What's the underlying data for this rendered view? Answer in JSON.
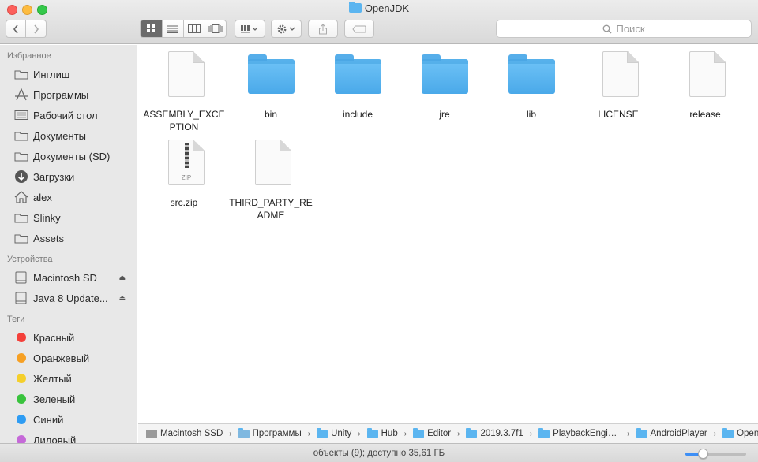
{
  "window": {
    "title": "OpenJDK"
  },
  "toolbar": {
    "back_icon": "chevron-left-icon",
    "forward_icon": "chevron-right-icon",
    "views": [
      "icon-view",
      "list-view",
      "column-view",
      "cover-flow-view"
    ],
    "selected_view": "icon-view",
    "search_placeholder": "Поиск"
  },
  "sidebar": {
    "favorites_header": "Избранное",
    "favorites": [
      {
        "label": "Инглиш",
        "icon": "folder-icon"
      },
      {
        "label": "Программы",
        "icon": "applications-icon"
      },
      {
        "label": "Рабочий стол",
        "icon": "desktop-icon"
      },
      {
        "label": "Документы",
        "icon": "folder-icon"
      },
      {
        "label": "Документы (SD)",
        "icon": "folder-icon"
      },
      {
        "label": "Загрузки",
        "icon": "downloads-icon"
      },
      {
        "label": "alex",
        "icon": "home-icon"
      },
      {
        "label": "Slinky",
        "icon": "folder-icon"
      },
      {
        "label": "Assets",
        "icon": "folder-icon"
      }
    ],
    "devices_header": "Устройства",
    "devices": [
      {
        "label": "Macintosh SD",
        "icon": "disk-icon"
      },
      {
        "label": "Java 8 Update...",
        "icon": "disk-icon"
      }
    ],
    "tags_header": "Теги",
    "tags": [
      {
        "label": "Красный",
        "color": "#f4403a"
      },
      {
        "label": "Оранжевый",
        "color": "#f6a023"
      },
      {
        "label": "Желтый",
        "color": "#f5cf2b"
      },
      {
        "label": "Зеленый",
        "color": "#39c33d"
      },
      {
        "label": "Синий",
        "color": "#2e9cf3"
      },
      {
        "label": "Лиловый",
        "color": "#c569d8"
      }
    ]
  },
  "files": [
    {
      "name": "ASSEMBLY_EXCEPTION",
      "type": "document"
    },
    {
      "name": "bin",
      "type": "folder"
    },
    {
      "name": "include",
      "type": "folder"
    },
    {
      "name": "jre",
      "type": "folder"
    },
    {
      "name": "lib",
      "type": "folder"
    },
    {
      "name": "LICENSE",
      "type": "document"
    },
    {
      "name": "release",
      "type": "document"
    },
    {
      "name": "src.zip",
      "type": "zip",
      "badge": "ZIP"
    },
    {
      "name": "THIRD_PARTY_README",
      "type": "document"
    }
  ],
  "pathbar": [
    {
      "label": "Macintosh SSD",
      "icon": "hd"
    },
    {
      "label": "Программы",
      "icon": "app"
    },
    {
      "label": "Unity",
      "icon": "folder"
    },
    {
      "label": "Hub",
      "icon": "folder"
    },
    {
      "label": "Editor",
      "icon": "folder"
    },
    {
      "label": "2019.3.7f1",
      "icon": "folder"
    },
    {
      "label": "PlaybackEngines",
      "icon": "folder"
    },
    {
      "label": "AndroidPlayer",
      "icon": "folder"
    },
    {
      "label": "OpenJDK",
      "icon": "folder"
    }
  ],
  "status": {
    "text": "объекты (9); доступно 35,61 ГБ",
    "icon_size_level": 0.25
  },
  "colors": {
    "folder": "#5bb5f0",
    "accent": "#3d8ff6"
  }
}
